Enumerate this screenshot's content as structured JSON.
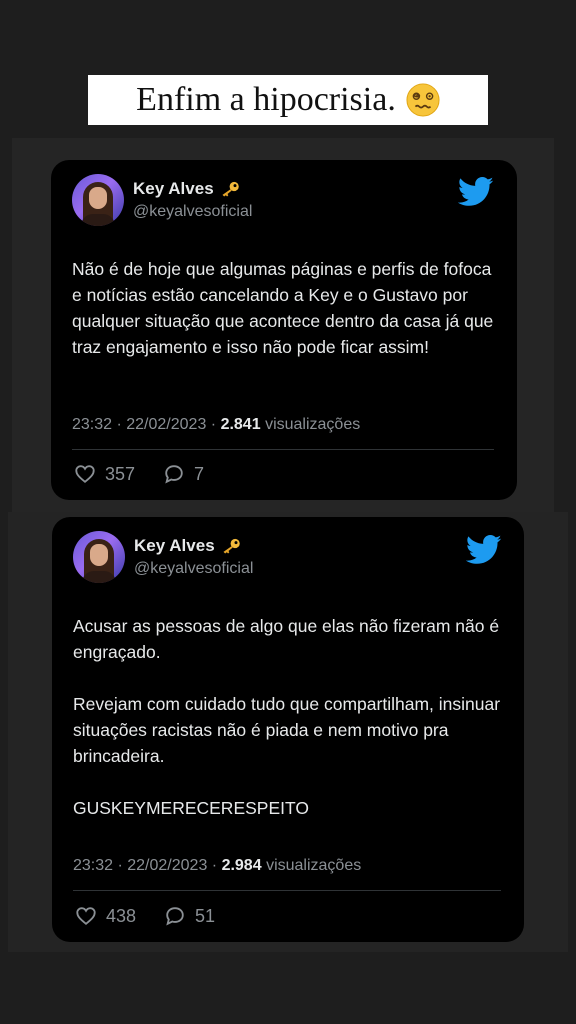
{
  "caption": {
    "text": "Enfim a hipocrisia."
  },
  "tweets": [
    {
      "name": "Key Alves",
      "handle": "@keyalvesoficial",
      "body": [
        "Não é de hoje que algumas páginas e perfis de fofoca e notícias estão cancelando a Key e o Gustavo por qualquer situação que acontece dentro da casa já que traz engajamento e isso não pode ficar assim!"
      ],
      "time": "23:32 · 22/02/2023 · ",
      "views_count": "2.841",
      "views_label": "visualizações",
      "likes": "357",
      "replies": "7"
    },
    {
      "name": "Key Alves",
      "handle": "@keyalvesoficial",
      "body": [
        "Acusar as pessoas de algo que elas não fizeram não é engraçado.",
        "Revejam com cuidado tudo que compartilham, insinuar situações racistas não é piada e nem motivo pra brincadeira.",
        "GUSKEYMERECERESPEITO"
      ],
      "time": "23:32 · 22/02/2023 · ",
      "views_count": "2.984",
      "views_label": "visualizações",
      "likes": "438",
      "replies": "51"
    }
  ],
  "colors": {
    "background": "#1e1e1e",
    "card": "#000000",
    "twitter_blue": "#1d9bf0",
    "text": "#e7e9ea",
    "muted": "#8b9095"
  },
  "icons": [
    "woozy-face-emoji",
    "key-emoji",
    "twitter-bird-icon",
    "heart-icon",
    "reply-bubble-icon"
  ]
}
